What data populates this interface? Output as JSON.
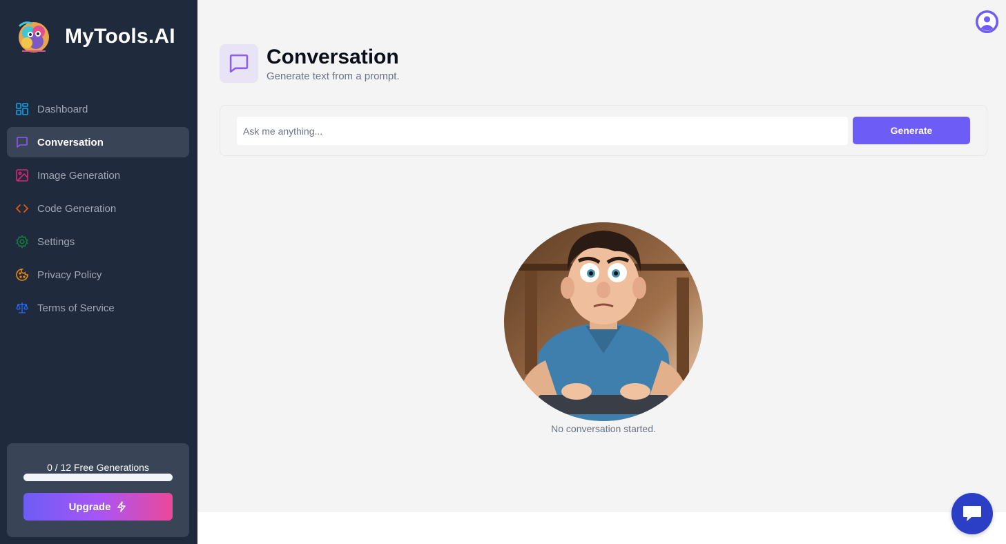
{
  "brand": {
    "name": "MyTools.AI"
  },
  "sidebar": {
    "items": [
      {
        "label": "Dashboard",
        "icon": "dashboard-grid-icon",
        "color": "#0ea5e9",
        "active": false
      },
      {
        "label": "Conversation",
        "icon": "message-square-icon",
        "color": "#8b5cf6",
        "active": true
      },
      {
        "label": "Image Generation",
        "icon": "image-icon",
        "color": "#db2777",
        "active": false
      },
      {
        "label": "Code Generation",
        "icon": "code-icon",
        "color": "#ea580c",
        "active": false
      },
      {
        "label": "Settings",
        "icon": "gear-icon",
        "color": "#15803d",
        "active": false
      },
      {
        "label": "Privacy Policy",
        "icon": "cookie-icon",
        "color": "#ea8b0c",
        "active": false
      },
      {
        "label": "Terms of Service",
        "icon": "scale-icon",
        "color": "#2563eb",
        "active": false
      }
    ],
    "free_generations": {
      "text": "0 / 12 Free Generations",
      "used": 0,
      "limit": 12
    },
    "upgrade_label": "Upgrade"
  },
  "header": {
    "title": "Conversation",
    "subtitle": "Generate text from a prompt.",
    "icon": "message-square-icon",
    "icon_color": "#8b5cf6"
  },
  "prompt": {
    "placeholder": "Ask me anything...",
    "value": "",
    "button_label": "Generate"
  },
  "empty_state": {
    "text": "No conversation started."
  },
  "colors": {
    "accent": "#6d5cf5",
    "sidebar_bg": "#202a3d",
    "main_bg": "#f4f4f5",
    "chat_widget": "#2b3fc6"
  }
}
